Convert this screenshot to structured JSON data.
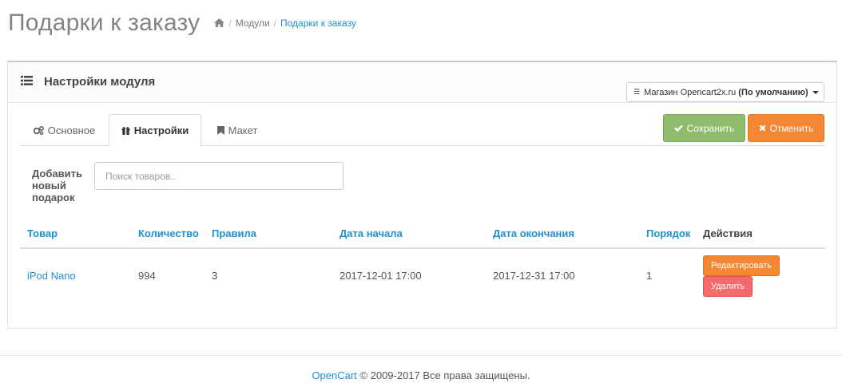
{
  "header": {
    "title": "Подарки к заказу",
    "breadcrumb": [
      {
        "label": "Модули"
      },
      {
        "label": "Подарки к заказу"
      }
    ]
  },
  "panel": {
    "title": "Настройки модуля",
    "store_select": {
      "prefix": "Магазин Opencart2x.ru",
      "selected": "(По умолчанию)"
    }
  },
  "tabs": [
    {
      "label": "Основное",
      "icon": "gears-icon",
      "active": false
    },
    {
      "label": "Настройки",
      "icon": "gift-icon",
      "active": true
    },
    {
      "label": "Макет",
      "icon": "bookmark-icon",
      "active": false
    }
  ],
  "actions": {
    "save_label": "Сохранить",
    "cancel_label": "Отменить"
  },
  "add_gift": {
    "label": "Добавить новый подарок",
    "placeholder": "Поиск товаров.."
  },
  "table": {
    "columns": [
      "Товар",
      "Количество",
      "Правила",
      "Дата начала",
      "Дата окончания",
      "Порядок",
      "Действия"
    ],
    "rows": [
      {
        "product": "iPod Nano",
        "quantity": "994",
        "rules": "3",
        "date_start": "2017-12-01 17:00",
        "date_end": "2017-12-31 17:00",
        "sort_order": "1"
      }
    ],
    "edit_label": "Редактировать",
    "delete_label": "Удалить"
  },
  "footer": {
    "link": "OpenCart",
    "text": " © 2009-2017 Все права защищены."
  },
  "colors": {
    "link": "#1e91cf",
    "save": "#8fbb6c",
    "cancel": "#f38733",
    "delete": "#f56b6b"
  }
}
